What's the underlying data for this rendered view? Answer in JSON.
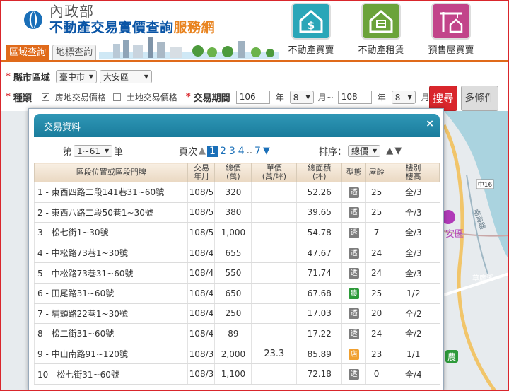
{
  "header": {
    "agency": "內政部",
    "title_main": "不動產交易實價查詢",
    "title_accent": "服務網",
    "tabs": [
      "區域查詢",
      "地標查詢"
    ],
    "nav": [
      {
        "label": "不動產買賣",
        "color": "#2aa6b8",
        "icon": "house-dollar-icon"
      },
      {
        "label": "不動產租賃",
        "color": "#6ba33a",
        "icon": "house-rent-icon"
      },
      {
        "label": "預售屋買賣",
        "color": "#c2448a",
        "icon": "crane-house-icon"
      }
    ]
  },
  "filters": {
    "county_label": "縣市區域",
    "city": "臺中市",
    "district": "大安區",
    "type_label": "種類",
    "opt_house": "房地交易價格",
    "opt_house_checked": true,
    "opt_land": "土地交易價格",
    "opt_land_checked": false,
    "period_label": "交易期間",
    "from_year": "106",
    "from_month": "8",
    "to_year": "108",
    "to_month": "8",
    "year_unit": "年",
    "month_unit": "月",
    "month_sep": "月~",
    "search_label": "搜尋",
    "more_label": "多條件"
  },
  "panel": {
    "title": "交易資料",
    "close": "×",
    "range_prefix": "第",
    "range_value": "1~61",
    "range_suffix": "筆",
    "page_label": "頁次",
    "pages": [
      "1",
      "2",
      "3",
      "4",
      "..",
      "7"
    ],
    "current_page": "1",
    "sort_label": "排序：",
    "sort_value": "總價",
    "columns": [
      "區段位置或區段門牌",
      "交易\n年月",
      "總價\n(萬)",
      "單價\n(萬/坪)",
      "總面積\n(坪)",
      "型態",
      "屋齡",
      "樓別\n樓高"
    ],
    "rows": [
      {
        "n": "1",
        "addr": "東西四路二段141巷31~60號",
        "ym": "108/5",
        "total": "320",
        "unit": "",
        "area": "52.26",
        "type": "透",
        "age": "25",
        "floor": "全/3"
      },
      {
        "n": "2",
        "addr": "東西八路二段50巷1~30號",
        "ym": "108/5",
        "total": "380",
        "unit": "",
        "area": "39.65",
        "type": "透",
        "age": "25",
        "floor": "全/3"
      },
      {
        "n": "3",
        "addr": "松七街1~30號",
        "ym": "108/5",
        "total": "1,000",
        "unit": "",
        "area": "54.78",
        "type": "透",
        "age": "7",
        "floor": "全/3"
      },
      {
        "n": "4",
        "addr": "中松路73巷1~30號",
        "ym": "108/4",
        "total": "655",
        "unit": "",
        "area": "47.67",
        "type": "透",
        "age": "24",
        "floor": "全/3"
      },
      {
        "n": "5",
        "addr": "中松路73巷31~60號",
        "ym": "108/4",
        "total": "550",
        "unit": "",
        "area": "71.74",
        "type": "透",
        "age": "24",
        "floor": "全/3"
      },
      {
        "n": "6",
        "addr": "田尾路31~60號",
        "ym": "108/4",
        "total": "650",
        "unit": "",
        "area": "67.68",
        "type": "農",
        "age": "25",
        "floor": "1/2"
      },
      {
        "n": "7",
        "addr": "埔頭路22巷1~30號",
        "ym": "108/4",
        "total": "250",
        "unit": "",
        "area": "17.03",
        "type": "透",
        "age": "20",
        "floor": "全/2"
      },
      {
        "n": "8",
        "addr": "松二街31~60號",
        "ym": "108/4",
        "total": "89",
        "unit": "",
        "area": "17.22",
        "type": "透",
        "age": "24",
        "floor": "全/2"
      },
      {
        "n": "9",
        "addr": "中山南路91~120號",
        "ym": "108/3",
        "total": "2,000",
        "unit": "23.3",
        "area": "85.89",
        "type": "店",
        "age": "23",
        "floor": "1/1"
      },
      {
        "n": "10",
        "addr": "松七街31~60號",
        "ym": "108/3",
        "total": "1,100",
        "unit": "",
        "area": "72.18",
        "type": "透",
        "age": "0",
        "floor": "全/4"
      }
    ],
    "type_colors": {
      "透": "#7d7d7d",
      "農": "#2e9a3a",
      "店": "#f0a030"
    }
  },
  "map": {
    "road_label": "中16",
    "label_nanhai": "南海路",
    "label_caopu": "草鷹溪",
    "label_area": "安區",
    "badge": "農"
  }
}
